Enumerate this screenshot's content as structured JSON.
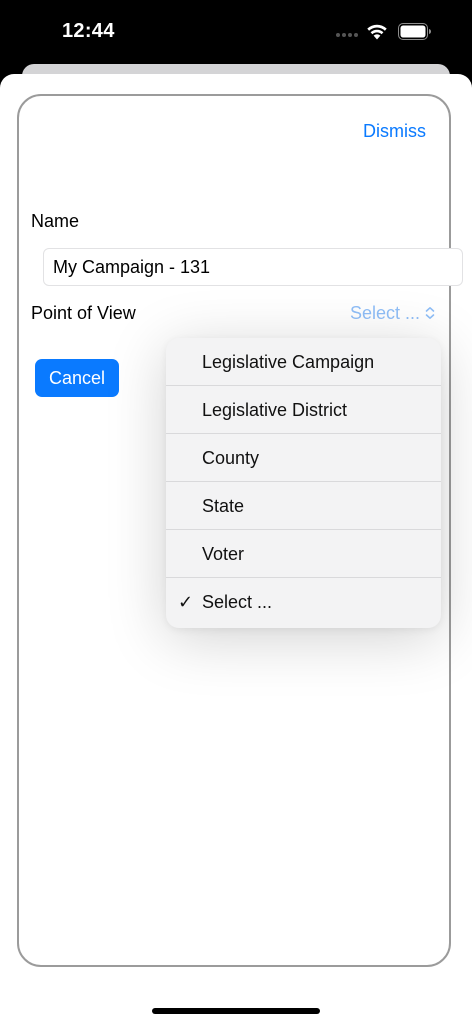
{
  "status_bar": {
    "time": "12:44",
    "icons": [
      "signal-dots-icon",
      "wifi-icon",
      "battery-icon"
    ]
  },
  "sheet": {
    "dismiss_label": "Dismiss",
    "name_label": "Name",
    "name_value": "My Campaign - 131",
    "point_of_view_label": "Point of View",
    "point_of_view_selected": "Select ...",
    "cancel_label": "Cancel"
  },
  "menu": {
    "options": [
      {
        "label": "Legislative Campaign",
        "checked": false
      },
      {
        "label": "Legislative District",
        "checked": false
      },
      {
        "label": "County",
        "checked": false
      },
      {
        "label": "State",
        "checked": false
      },
      {
        "label": "Voter",
        "checked": false
      },
      {
        "label": "Select ...",
        "checked": true
      }
    ],
    "check_glyph": "✓"
  },
  "colors": {
    "accent": "#0a7aff",
    "picker_text": "#8fbef7",
    "menu_background": "#f3f3f4"
  }
}
